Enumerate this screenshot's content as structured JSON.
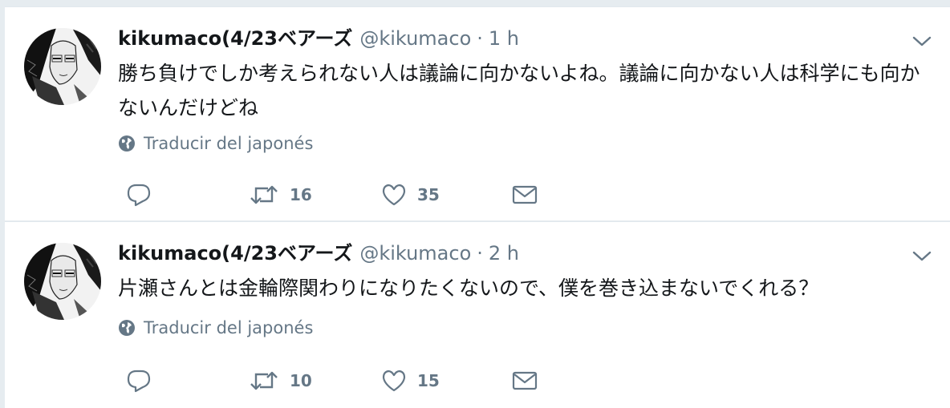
{
  "tweets": [
    {
      "display_name": "kikumaco(4/23ベアーズ",
      "handle": "@kikumaco",
      "separator": "·",
      "time": "1 h",
      "text": "勝ち負けでしか考えられない人は議論に向かないよね。議論に向かない人は科学にも向かないんだけどね",
      "translate": "Traducir del japonés",
      "retweets": "16",
      "likes": "35"
    },
    {
      "display_name": "kikumaco(4/23ベアーズ",
      "handle": "@kikumaco",
      "separator": "·",
      "time": "2 h",
      "text": "片瀬さんとは金輪際関わりになりたくないので、僕を巻き込まないでくれる？",
      "translate": "Traducir del japonés",
      "retweets": "10",
      "likes": "15"
    }
  ],
  "icons": {
    "reply": "reply-icon",
    "retweet": "retweet-icon",
    "like": "heart-icon",
    "dm": "envelope-icon",
    "caret": "chevron-down-icon",
    "globe": "globe-icon"
  },
  "colors": {
    "text": "#14171a",
    "secondary": "#657786",
    "background": "#e6ecf0",
    "card": "#ffffff"
  }
}
